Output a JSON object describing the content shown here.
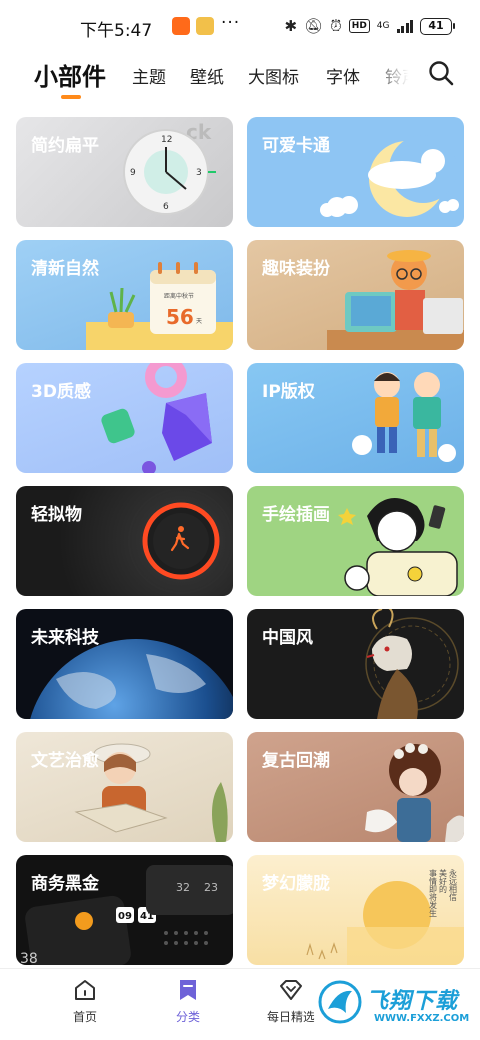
{
  "status_bar": {
    "time": "下午5:47",
    "network": "4G",
    "hd": "HD",
    "battery": "41"
  },
  "tabs": {
    "items": [
      "小部件",
      "主题",
      "壁纸",
      "大图标",
      "字体",
      "铃声"
    ],
    "active": "小部件"
  },
  "cards": [
    {
      "label": "简约扁平",
      "color": "#d7d7d9"
    },
    {
      "label": "可爱卡通",
      "color": "#8ec5f3"
    },
    {
      "label": "清新自然",
      "color": "#8fc7f0",
      "calendar_text": "距离中秋节",
      "calendar_value": "56",
      "calendar_unit": "天"
    },
    {
      "label": "趣味装扮",
      "color": "#dbb98f"
    },
    {
      "label": "3D质感",
      "color": "#a9c8ff"
    },
    {
      "label": "IP版权",
      "color": "#79bdf0"
    },
    {
      "label": "轻拟物",
      "color": "#262626"
    },
    {
      "label": "手绘插画",
      "color": "#9fd482"
    },
    {
      "label": "未来科技",
      "color": "#0c0f17"
    },
    {
      "label": "中国风",
      "color": "#1b1b1b"
    },
    {
      "label": "文艺治愈",
      "color": "#e8ddca"
    },
    {
      "label": "复古回潮",
      "color": "#c79a84"
    },
    {
      "label": "商务黑金",
      "color": "#141414",
      "widget_values": [
        "09",
        "41",
        "32",
        "23",
        "38"
      ]
    },
    {
      "label": "梦幻朦胧",
      "color": "#fbe9bf",
      "poem": [
        "美好的",
        "永远相信",
        "事情即将发生"
      ]
    }
  ],
  "bottom_nav": {
    "items": [
      {
        "label": "首页",
        "icon": "home-icon"
      },
      {
        "label": "分类",
        "icon": "bookmark-icon"
      },
      {
        "label": "每日精选",
        "icon": "diamond-icon"
      }
    ],
    "active": "分类"
  },
  "watermark": {
    "title": "飞翔下载",
    "url": "WWW.FXXZ.COM"
  },
  "colors": {
    "accent": "#ff8a1a",
    "nav_active": "#6e62d8"
  }
}
